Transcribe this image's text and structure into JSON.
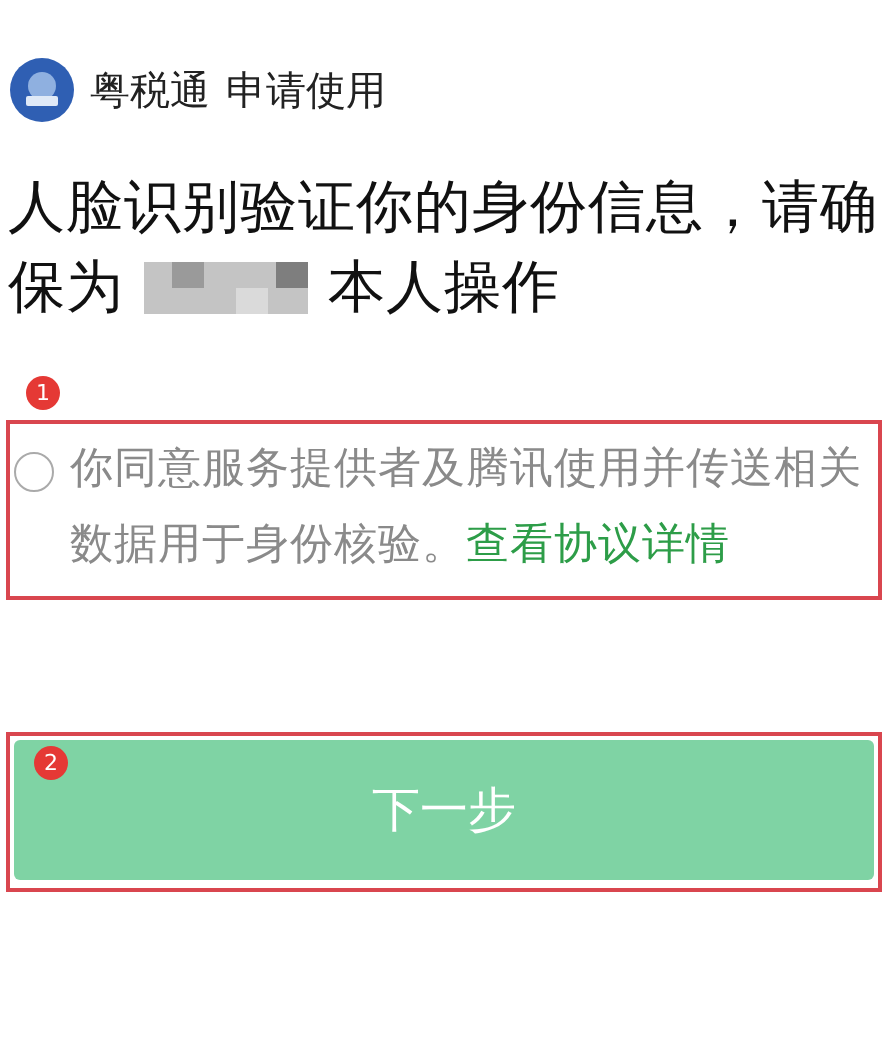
{
  "header": {
    "app_name": "粤税通",
    "action": "申请使用"
  },
  "heading": {
    "line_1": "人脸识别验证你的身份信息，请确",
    "line_2_start": "保为",
    "name_redacted": true,
    "line_2_end": "本人操作"
  },
  "consent": {
    "checked": false,
    "text": "你同意服务提供者及腾讯使用并传送相关数据用于身份核验。",
    "link": "查看协议详情"
  },
  "next_button": {
    "label": "下一步",
    "disabled": true
  },
  "annotations": [
    {
      "label": "1"
    },
    {
      "label": "2"
    }
  ]
}
